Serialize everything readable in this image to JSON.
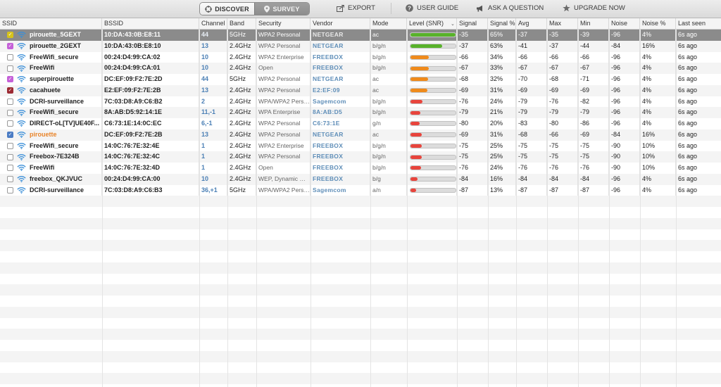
{
  "toolbar": {
    "discover_label": "DISCOVER",
    "survey_label": "SURVEY",
    "export_label": "EXPORT",
    "user_guide_label": "USER GUIDE",
    "ask_label": "ASK A QUESTION",
    "upgrade_label": "UPGRADE NOW"
  },
  "columns": [
    "SSID",
    "BSSID",
    "Channel",
    "Band",
    "Security",
    "Vendor",
    "Mode",
    "Level (SNR)",
    "Signal",
    "Signal %",
    "Avg",
    "Max",
    "Min",
    "Noise",
    "Noise %",
    "Last seen"
  ],
  "level_colors": {
    "green": "#58b22a",
    "orange": "#ef8a1b",
    "red": "#e8443c"
  },
  "checkbox_colors": {
    "yellow": "#d6c21a",
    "pink": "#c561d8",
    "maroon": "#9c2a33",
    "blue": "#4b7cc4"
  },
  "rows": [
    {
      "ssid": "pirouette_5GEXT",
      "bssid": "10:DA:43:0B:E8:11",
      "channel": "44",
      "band": "5GHz",
      "security": "WPA2 Personal",
      "vendor": "NETGEAR",
      "mode": "ac",
      "level": 100,
      "level_color": "green",
      "signal": "-35",
      "signal_pct": "65%",
      "avg": "-37",
      "max": "-35",
      "min": "-39",
      "noise": "-96",
      "noise_pct": "4%",
      "last_seen": "6s ago",
      "checked": "yellow",
      "selected": true
    },
    {
      "ssid": "pirouette_2GEXT",
      "bssid": "10:DA:43:0B:E8:10",
      "channel": "13",
      "band": "2.4GHz",
      "security": "WPA2 Personal",
      "vendor": "NETGEAR",
      "mode": "b/g/n",
      "level": 70,
      "level_color": "green",
      "signal": "-37",
      "signal_pct": "63%",
      "avg": "-41",
      "max": "-37",
      "min": "-44",
      "noise": "-84",
      "noise_pct": "16%",
      "last_seen": "6s ago",
      "checked": "pink"
    },
    {
      "ssid": "FreeWifi_secure",
      "bssid": "00:24:D4:99:CA:02",
      "channel": "10",
      "band": "2.4GHz",
      "security": "WPA2 Enterprise",
      "vendor": "FREEBOX",
      "mode": "b/g/n",
      "level": 40,
      "level_color": "orange",
      "signal": "-66",
      "signal_pct": "34%",
      "avg": "-66",
      "max": "-66",
      "min": "-66",
      "noise": "-96",
      "noise_pct": "4%",
      "last_seen": "6s ago"
    },
    {
      "ssid": "FreeWifi",
      "bssid": "00:24:D4:99:CA:01",
      "channel": "10",
      "band": "2.4GHz",
      "security": "Open",
      "vendor": "FREEBOX",
      "mode": "b/g/n",
      "level": 40,
      "level_color": "orange",
      "signal": "-67",
      "signal_pct": "33%",
      "avg": "-67",
      "max": "-67",
      "min": "-67",
      "noise": "-96",
      "noise_pct": "4%",
      "last_seen": "6s ago"
    },
    {
      "ssid": "superpirouette",
      "bssid": "DC:EF:09:F2:7E:2D",
      "channel": "44",
      "band": "5GHz",
      "security": "WPA2 Personal",
      "vendor": "NETGEAR",
      "mode": "ac",
      "level": 39,
      "level_color": "orange",
      "signal": "-68",
      "signal_pct": "32%",
      "avg": "-70",
      "max": "-68",
      "min": "-71",
      "noise": "-96",
      "noise_pct": "4%",
      "last_seen": "6s ago",
      "checked": "pink"
    },
    {
      "ssid": "cacahuete",
      "bssid": "E2:EF:09:F2:7E:2B",
      "channel": "13",
      "band": "2.4GHz",
      "security": "WPA2 Personal",
      "vendor": "E2:EF:09",
      "mode": "ac",
      "level": 38,
      "level_color": "orange",
      "signal": "-69",
      "signal_pct": "31%",
      "avg": "-69",
      "max": "-69",
      "min": "-69",
      "noise": "-96",
      "noise_pct": "4%",
      "last_seen": "6s ago",
      "checked": "maroon"
    },
    {
      "ssid": "DCRI-surveillance",
      "bssid": "7C:03:D8:A9:C6:B2",
      "channel": "2",
      "band": "2.4GHz",
      "security": "WPA/WPA2 Personal",
      "vendor": "Sagemcom",
      "mode": "b/g/n",
      "level": 26,
      "level_color": "red",
      "signal": "-76",
      "signal_pct": "24%",
      "avg": "-79",
      "max": "-76",
      "min": "-82",
      "noise": "-96",
      "noise_pct": "4%",
      "last_seen": "6s ago"
    },
    {
      "ssid": "FreeWifi_secure",
      "bssid": "8A:AB:D5:92:14:1E",
      "channel": "11,-1",
      "band": "2.4GHz",
      "security": "WPA Enterprise",
      "vendor": "8A:AB:D5",
      "mode": "b/g/n",
      "level": 22,
      "level_color": "red",
      "signal": "-79",
      "signal_pct": "21%",
      "avg": "-79",
      "max": "-79",
      "min": "-79",
      "noise": "-96",
      "noise_pct": "4%",
      "last_seen": "6s ago"
    },
    {
      "ssid": "DIRECT-oL[TV]UE40F...",
      "bssid": "C6:73:1E:14:0C:EC",
      "channel": "6,-1",
      "band": "2.4GHz",
      "security": "WPA2 Personal",
      "vendor": "C6:73:1E",
      "mode": "g/n",
      "level": 21,
      "level_color": "red",
      "signal": "-80",
      "signal_pct": "20%",
      "avg": "-83",
      "max": "-80",
      "min": "-86",
      "noise": "-96",
      "noise_pct": "4%",
      "last_seen": "6s ago"
    },
    {
      "ssid": "pirouette",
      "bssid": "DC:EF:09:F2:7E:2B",
      "channel": "13",
      "band": "2.4GHz",
      "security": "WPA2 Personal",
      "vendor": "NETGEAR",
      "mode": "ac",
      "level": 25,
      "level_color": "red",
      "signal": "-69",
      "signal_pct": "31%",
      "avg": "-68",
      "max": "-66",
      "min": "-69",
      "noise": "-84",
      "noise_pct": "16%",
      "last_seen": "6s ago",
      "checked": "blue",
      "ssid_color": "#e8842a"
    },
    {
      "ssid": "FreeWifi_secure",
      "bssid": "14:0C:76:7E:32:4E",
      "channel": "1",
      "band": "2.4GHz",
      "security": "WPA2 Enterprise",
      "vendor": "FREEBOX",
      "mode": "b/g/n",
      "level": 25,
      "level_color": "red",
      "signal": "-75",
      "signal_pct": "25%",
      "avg": "-75",
      "max": "-75",
      "min": "-75",
      "noise": "-90",
      "noise_pct": "10%",
      "last_seen": "6s ago"
    },
    {
      "ssid": "Freebox-7E324B",
      "bssid": "14:0C:76:7E:32:4C",
      "channel": "1",
      "band": "2.4GHz",
      "security": "WPA2 Personal",
      "vendor": "FREEBOX",
      "mode": "b/g/n",
      "level": 25,
      "level_color": "red",
      "signal": "-75",
      "signal_pct": "25%",
      "avg": "-75",
      "max": "-75",
      "min": "-75",
      "noise": "-90",
      "noise_pct": "10%",
      "last_seen": "6s ago"
    },
    {
      "ssid": "FreeWifi",
      "bssid": "14:0C:76:7E:32:4D",
      "channel": "1",
      "band": "2.4GHz",
      "security": "Open",
      "vendor": "FREEBOX",
      "mode": "b/g/n",
      "level": 24,
      "level_color": "red",
      "signal": "-76",
      "signal_pct": "24%",
      "avg": "-76",
      "max": "-76",
      "min": "-76",
      "noise": "-90",
      "noise_pct": "10%",
      "last_seen": "6s ago"
    },
    {
      "ssid": "freebox_QKJVUC",
      "bssid": "00:24:D4:99:CA:00",
      "channel": "10",
      "band": "2.4GHz",
      "security": "WEP, Dynamic WEP",
      "vendor": "FREEBOX",
      "mode": "b/g",
      "level": 16,
      "level_color": "red",
      "signal": "-84",
      "signal_pct": "16%",
      "avg": "-84",
      "max": "-84",
      "min": "-84",
      "noise": "-96",
      "noise_pct": "4%",
      "last_seen": "6s ago"
    },
    {
      "ssid": "DCRI-surveillance",
      "bssid": "7C:03:D8:A9:C6:B3",
      "channel": "36,+1",
      "band": "5GHz",
      "security": "WPA/WPA2 Personal",
      "vendor": "Sagemcom",
      "mode": "a/n",
      "level": 13,
      "level_color": "red",
      "signal": "-87",
      "signal_pct": "13%",
      "avg": "-87",
      "max": "-87",
      "min": "-87",
      "noise": "-96",
      "noise_pct": "4%",
      "last_seen": "6s ago"
    }
  ]
}
